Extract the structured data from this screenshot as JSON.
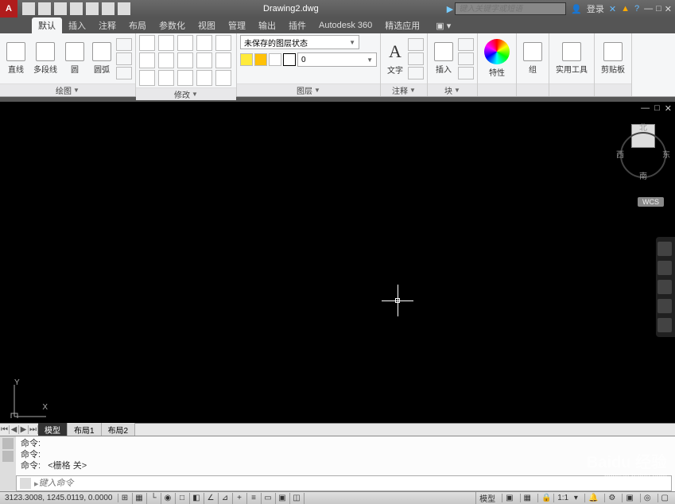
{
  "title": "Drawing2.dwg",
  "search_placeholder": "键入关键字或短语",
  "login": "登录",
  "menu": {
    "tabs": [
      "默认",
      "插入",
      "注释",
      "布局",
      "参数化",
      "视图",
      "管理",
      "输出",
      "插件",
      "Autodesk 360",
      "精选应用"
    ],
    "active": 0
  },
  "ribbon": {
    "draw": {
      "title": "绘图",
      "line": "直线",
      "polyline": "多段线",
      "circle": "圆",
      "arc": "圆弧"
    },
    "modify": {
      "title": "修改"
    },
    "layer": {
      "title": "图层",
      "unsaved": "未保存的图层状态",
      "current": "0"
    },
    "annot": {
      "title": "注释",
      "text": "文字"
    },
    "block": {
      "title": "块",
      "insert": "插入"
    },
    "props": {
      "title": "特性"
    },
    "group": {
      "title": "组"
    },
    "util": {
      "title": "实用工具"
    },
    "clip": {
      "title": "剪贴板"
    }
  },
  "viewcube": {
    "n": "北",
    "s": "南",
    "e": "东",
    "w": "西",
    "wcs": "WCS"
  },
  "ucs": {
    "x": "X",
    "y": "Y"
  },
  "layout": {
    "model": "模型",
    "l1": "布局1",
    "l2": "布局2"
  },
  "cmd": {
    "label": "命令:",
    "last": "<栅格 关>",
    "placeholder": "键入命令"
  },
  "status": {
    "coords": "3123.3008, 1245.0119, 0.0000",
    "model": "模型",
    "scale": "1:1"
  },
  "watermark": {
    "main": "Baidu 经验",
    "sub": "jingyan.baidu.com"
  }
}
